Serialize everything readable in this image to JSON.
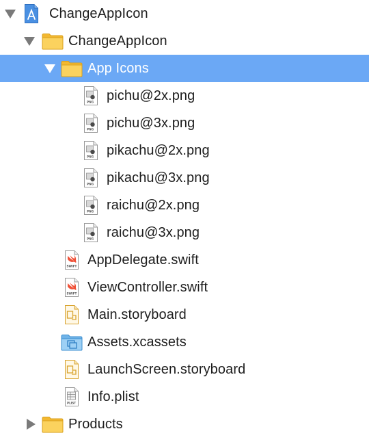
{
  "navigator": {
    "project": {
      "label": "ChangeAppIcon",
      "icon": "xcode-project-icon"
    },
    "group": {
      "label": "ChangeAppIcon",
      "icon": "folder-icon"
    },
    "app_icons_group": {
      "label": "App Icons",
      "icon": "folder-icon"
    },
    "png_files": [
      {
        "label": "pichu@2x.png"
      },
      {
        "label": "pichu@3x.png"
      },
      {
        "label": "pikachu@2x.png"
      },
      {
        "label": "pikachu@3x.png"
      },
      {
        "label": "raichu@2x.png"
      },
      {
        "label": "raichu@3x.png"
      }
    ],
    "png_badge": "PNG",
    "swift_badge": "SWIFT",
    "plist_badge": "PLIST",
    "files": [
      {
        "label": "AppDelegate.swift",
        "icon": "swift-file-icon"
      },
      {
        "label": "ViewController.swift",
        "icon": "swift-file-icon"
      },
      {
        "label": "Main.storyboard",
        "icon": "storyboard-file-icon"
      },
      {
        "label": "Assets.xcassets",
        "icon": "asset-catalog-icon"
      },
      {
        "label": "LaunchScreen.storyboard",
        "icon": "storyboard-file-icon"
      },
      {
        "label": "Info.plist",
        "icon": "plist-file-icon"
      }
    ],
    "products_group": {
      "label": "Products",
      "icon": "folder-icon"
    },
    "selection_color": "#6ba8f5",
    "folder_color": "#f8c74a"
  }
}
